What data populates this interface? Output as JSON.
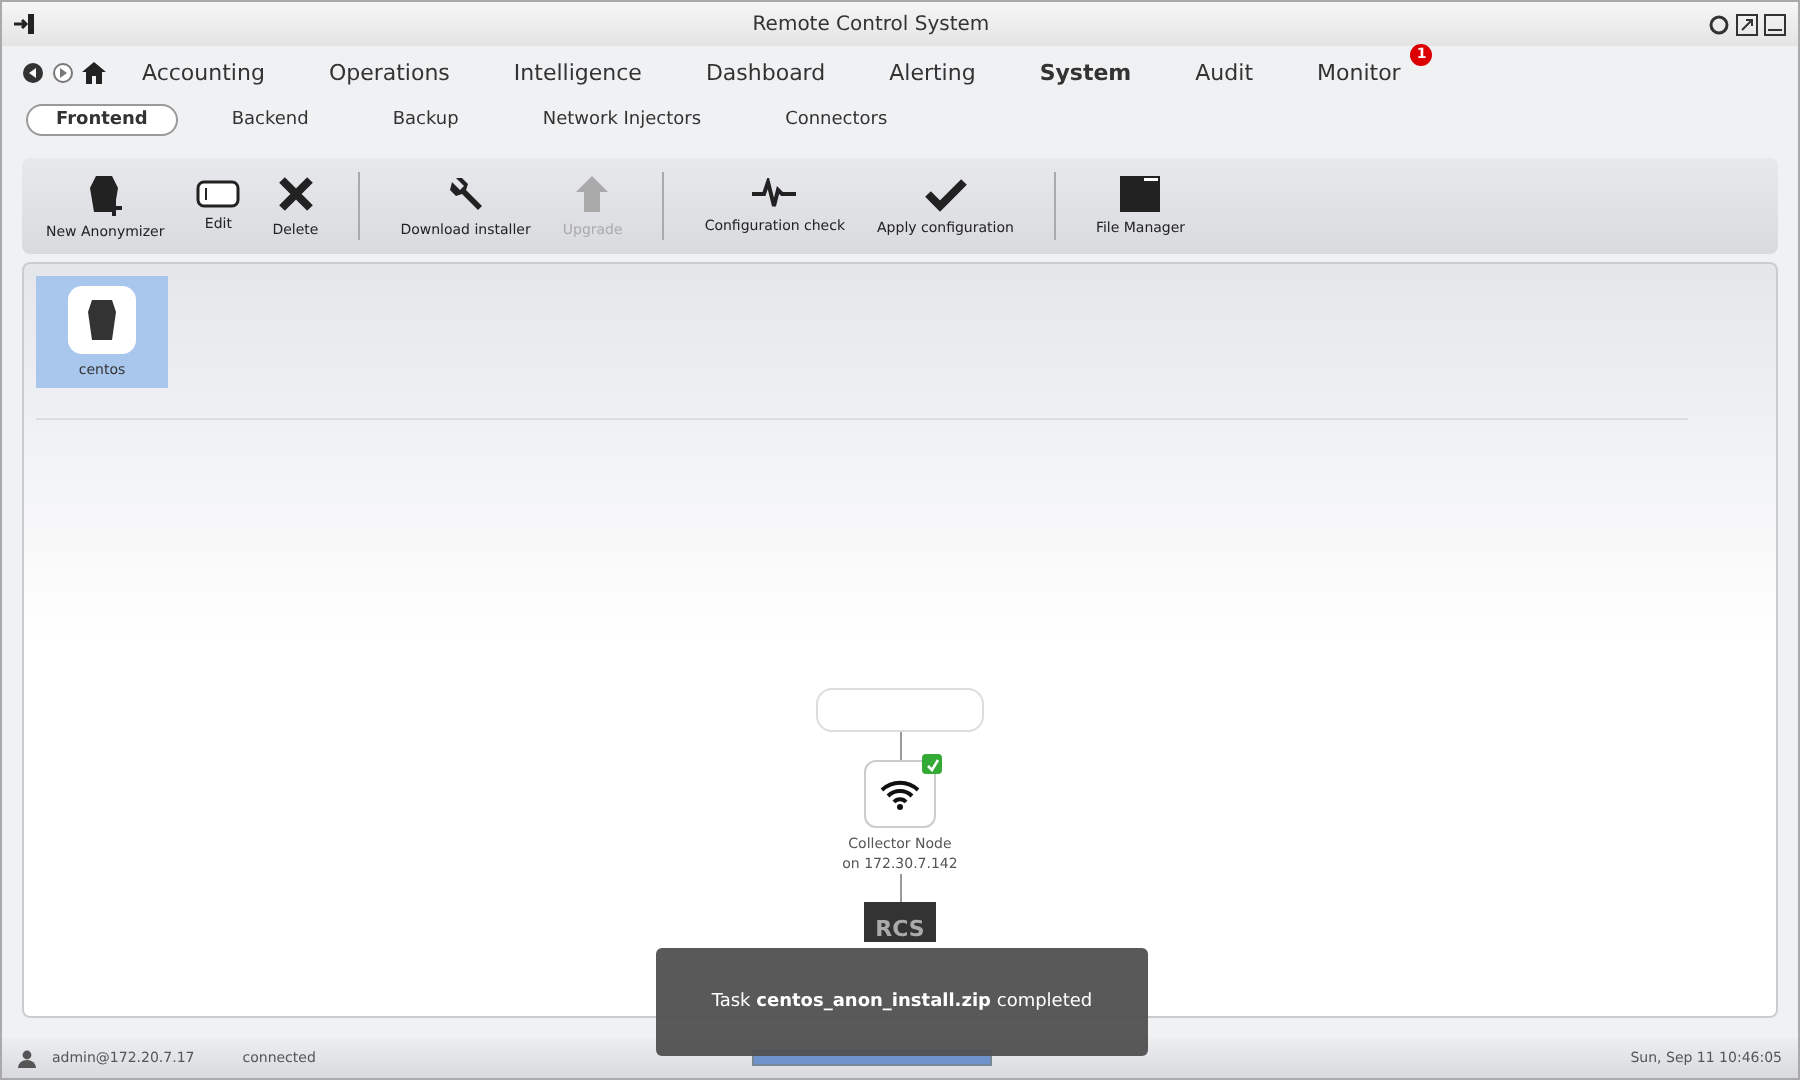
{
  "window": {
    "title": "Remote Control System"
  },
  "nav": {
    "items": [
      {
        "label": "Accounting",
        "selected": false
      },
      {
        "label": "Operations",
        "selected": false
      },
      {
        "label": "Intelligence",
        "selected": false
      },
      {
        "label": "Dashboard",
        "selected": false
      },
      {
        "label": "Alerting",
        "selected": false
      },
      {
        "label": "System",
        "selected": true
      },
      {
        "label": "Audit",
        "selected": false
      },
      {
        "label": "Monitor",
        "selected": false,
        "badge": "1"
      }
    ]
  },
  "subtabs": [
    {
      "label": "Frontend",
      "selected": true
    },
    {
      "label": "Backend",
      "selected": false
    },
    {
      "label": "Backup",
      "selected": false
    },
    {
      "label": "Network Injectors",
      "selected": false
    },
    {
      "label": "Connectors",
      "selected": false
    }
  ],
  "toolbar": [
    {
      "kind": "anonymizer",
      "label": "New Anonymizer",
      "disabled": false
    },
    {
      "kind": "edit",
      "label": "Edit",
      "disabled": false
    },
    {
      "kind": "delete",
      "label": "Delete",
      "disabled": false
    },
    {
      "kind": "separator"
    },
    {
      "kind": "wrench",
      "label": "Download installer",
      "disabled": false
    },
    {
      "kind": "upgrade",
      "label": "Upgrade",
      "disabled": true
    },
    {
      "kind": "separator"
    },
    {
      "kind": "pulse",
      "label": "Configuration check",
      "disabled": false
    },
    {
      "kind": "check",
      "label": "Apply configuration",
      "disabled": false
    },
    {
      "kind": "separator"
    },
    {
      "kind": "window",
      "label": "File Manager",
      "disabled": false
    }
  ],
  "anonymizers": [
    {
      "label": "centos",
      "selected": true
    }
  ],
  "diagram": {
    "collector": {
      "label": "Collector Node",
      "address": "on 172.30.7.142",
      "ok": true
    },
    "server": {
      "label": "RCS"
    }
  },
  "toast": {
    "prefix": "Task",
    "file": "centos_anon_install.zip",
    "suffix": "completed"
  },
  "status_bar": {
    "user": "admin@172.20.7.17",
    "state": "connected",
    "progress": {
      "level": 1
    },
    "time": "Sun, Sep 11 10:46:05"
  }
}
